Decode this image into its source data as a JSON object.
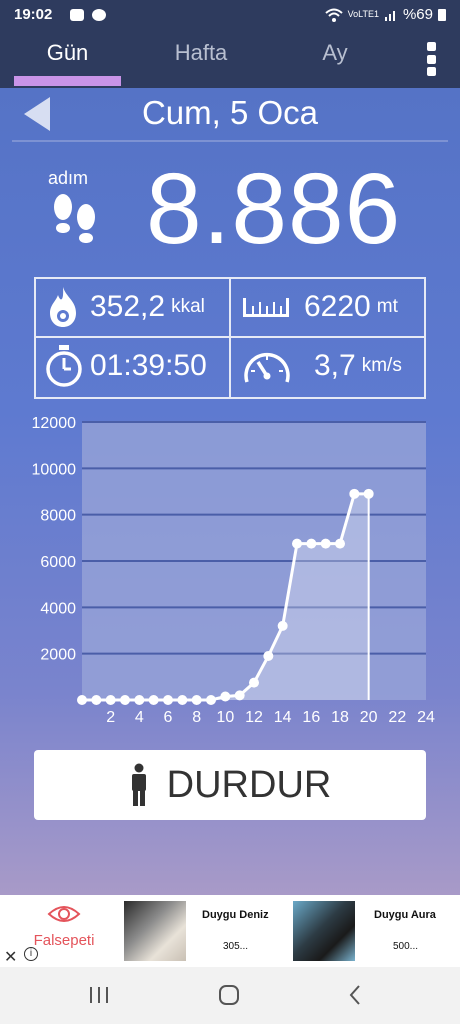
{
  "status_bar": {
    "time": "19:02",
    "network": "VoLTE1",
    "battery": "%69"
  },
  "tabs": [
    {
      "label": "Gün",
      "active": true
    },
    {
      "label": "Hafta",
      "active": false
    },
    {
      "label": "Ay",
      "active": false
    }
  ],
  "date": "Cum, 5 Oca",
  "steps": {
    "label": "adım",
    "value": "8.886"
  },
  "stats": {
    "calories": {
      "value": "352,2",
      "unit": "kkal",
      "icon": "flame-icon"
    },
    "distance": {
      "value": "6220",
      "unit": "mt",
      "icon": "ruler-icon"
    },
    "duration": {
      "value": "01:39:50",
      "icon": "stopwatch-icon"
    },
    "speed": {
      "value": "3,7",
      "unit": "km/s",
      "icon": "speedometer-icon"
    }
  },
  "chart_data": {
    "type": "line",
    "x": [
      0,
      1,
      2,
      3,
      4,
      5,
      6,
      7,
      8,
      9,
      10,
      11,
      12,
      13,
      14,
      15,
      16,
      17,
      18,
      19,
      20
    ],
    "values": [
      0,
      0,
      0,
      0,
      0,
      0,
      0,
      0,
      0,
      0,
      150,
      200,
      750,
      1900,
      3200,
      6750,
      6750,
      6750,
      6750,
      8900,
      8900
    ],
    "xticks": [
      "2",
      "4",
      "6",
      "8",
      "10",
      "12",
      "14",
      "16",
      "18",
      "20",
      "22",
      "24"
    ],
    "yticks": [
      "2000",
      "4000",
      "6000",
      "8000",
      "10000",
      "12000"
    ],
    "xlim": [
      0,
      24
    ],
    "ylim": [
      0,
      12000
    ],
    "grid": true,
    "line_color": "#ffffff",
    "plot_bg": "#99a6d8"
  },
  "stop_button": {
    "label": "DURDUR",
    "icon": "person-icon"
  },
  "ad": {
    "brand": "Falsepeti",
    "items": [
      {
        "title": "Duygu Deniz",
        "subtitle": "305..."
      },
      {
        "title": "Duygu Aura",
        "subtitle": "500..."
      }
    ]
  },
  "colors": {
    "header": "#2e3b5e",
    "tab_indicator": "#c994e8",
    "background_top": "#5573c6",
    "background_bottom": "#a89ac8"
  }
}
